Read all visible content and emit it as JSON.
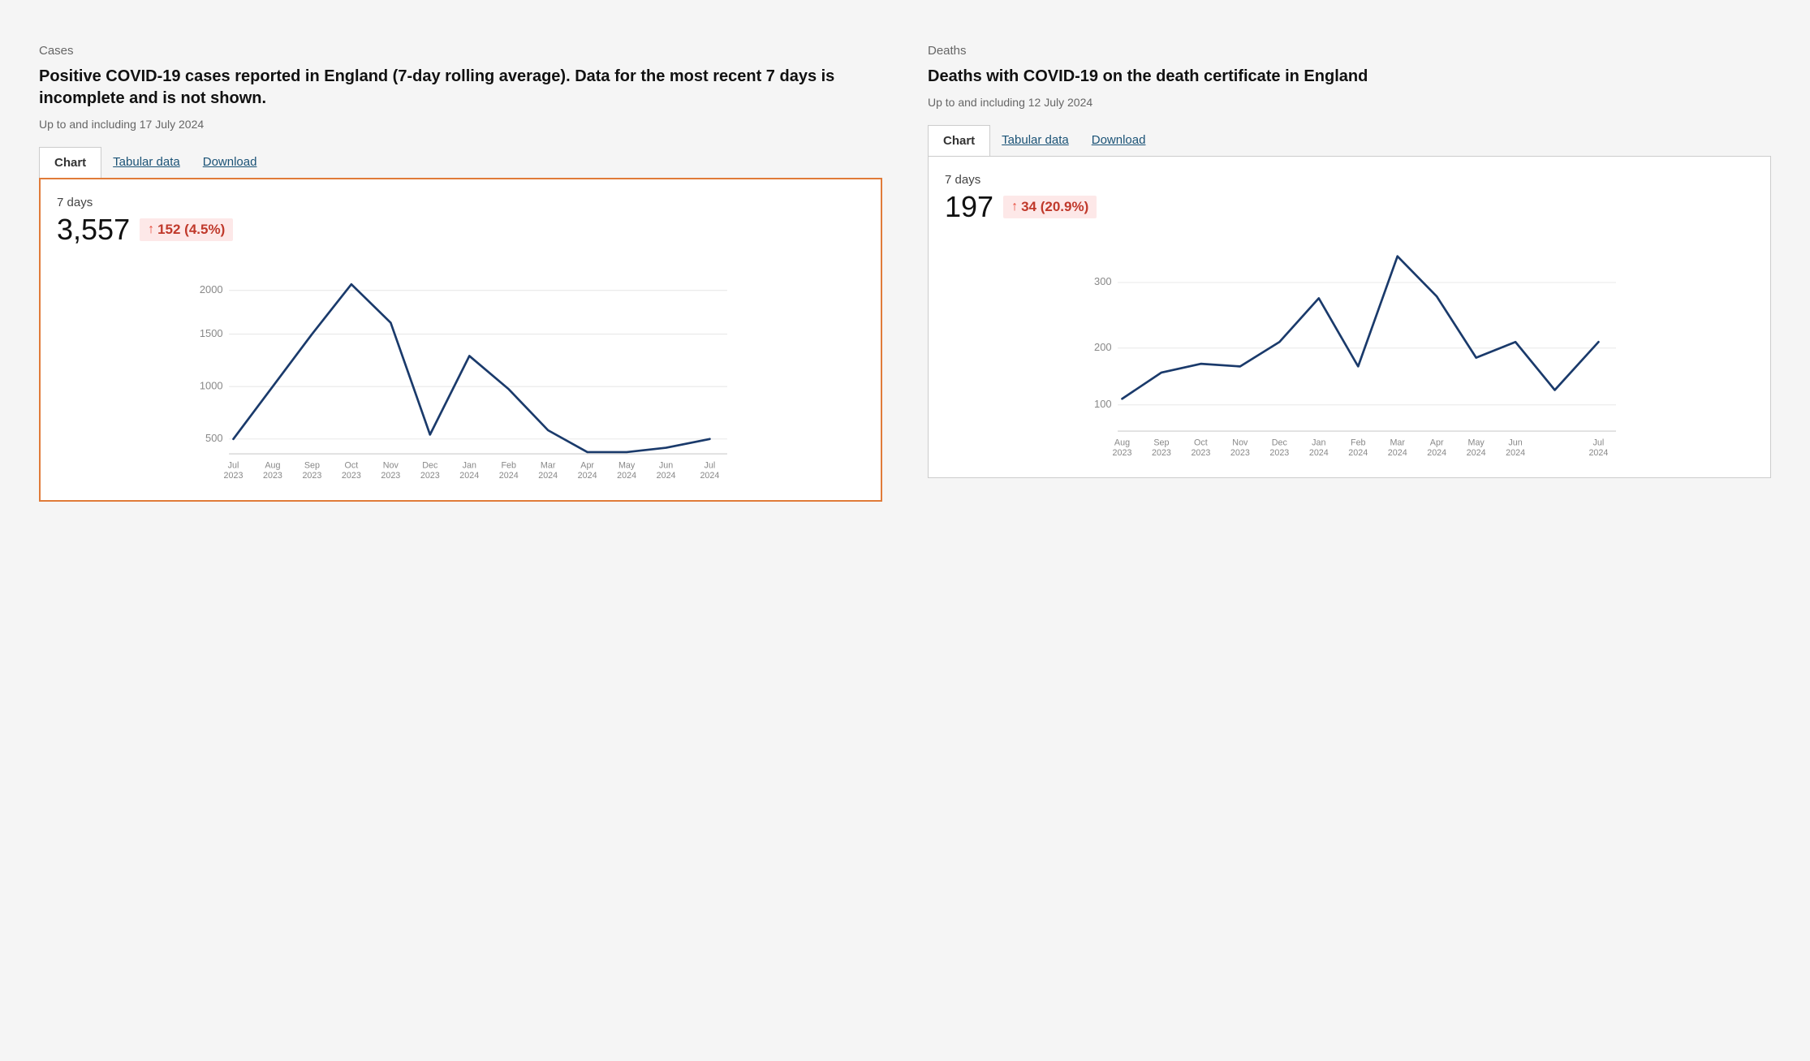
{
  "cases": {
    "section_label": "Cases",
    "title": "Positive COVID-19 cases reported in England (7-day rolling average). Data for the most recent 7 days is incomplete and is not shown.",
    "subtitle": "Up to and including 17 July 2024",
    "tabs": [
      "Chart",
      "Tabular data",
      "Download"
    ],
    "active_tab": "Chart",
    "stat_period": "7 days",
    "stat_value": "3,557",
    "stat_change": "152 (4.5%)",
    "y_labels": [
      "2000",
      "1500",
      "1000",
      "500"
    ],
    "x_labels": [
      "Jul\n2023",
      "Aug\n2023",
      "Sep\n2023",
      "Oct\n2023",
      "Nov\n2023",
      "Dec\n2023",
      "Jan\n2024",
      "Feb\n2024",
      "Mar\n2024",
      "Apr\n2024",
      "May\n2024",
      "Jun\n2024",
      "Jul\n2024"
    ]
  },
  "deaths": {
    "section_label": "Deaths",
    "title": "Deaths with COVID-19 on the death certificate in England",
    "subtitle": "Up to and including 12 July 2024",
    "tabs": [
      "Chart",
      "Tabular data",
      "Download"
    ],
    "active_tab": "Chart",
    "stat_period": "7 days",
    "stat_value": "197",
    "stat_change": "34 (20.9%)",
    "y_labels": [
      "300",
      "200",
      "100"
    ],
    "x_labels": [
      "Aug\n2023",
      "Sep\n2023",
      "Oct\n2023",
      "Nov\n2023",
      "Dec\n2023",
      "Jan\n2024",
      "Feb\n2024",
      "Mar\n2024",
      "Apr\n2024",
      "May\n2024",
      "Jun\n2024",
      "Jul\n2024"
    ]
  },
  "icons": {
    "arrow_up": "↑"
  }
}
